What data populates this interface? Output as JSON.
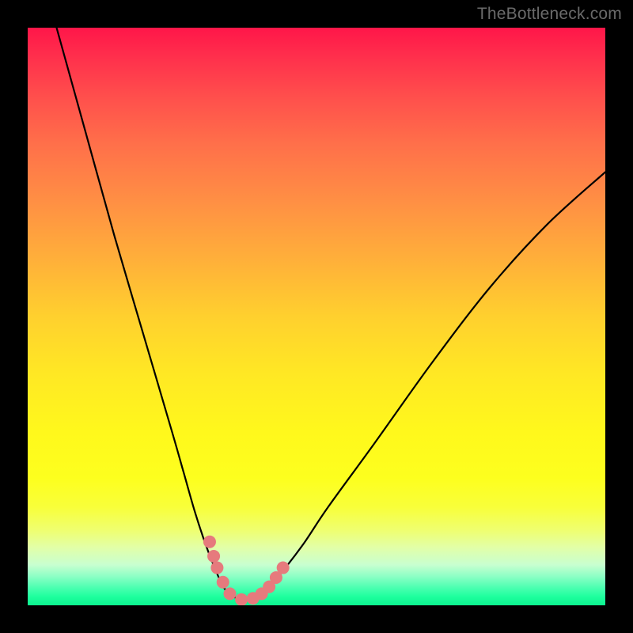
{
  "watermark": "TheBottleneck.com",
  "chart_data": {
    "type": "line",
    "title": "",
    "xlabel": "",
    "ylabel": "",
    "xlim": [
      0,
      100
    ],
    "ylim": [
      0,
      100
    ],
    "grid": false,
    "series": [
      {
        "name": "curve",
        "x": [
          5,
          10,
          15,
          20,
          25,
          27,
          29,
          31,
          33,
          34,
          35,
          36,
          37,
          38,
          39,
          40,
          42,
          45,
          48,
          52,
          60,
          70,
          80,
          90,
          100
        ],
        "y": [
          100,
          82,
          64,
          47,
          30,
          23,
          16,
          10,
          5,
          3,
          2,
          1.3,
          1,
          1,
          1.2,
          1.8,
          3.5,
          7,
          11,
          17,
          28,
          42,
          55,
          66,
          75
        ]
      }
    ],
    "markers": [
      {
        "x": 31.5,
        "y": 11
      },
      {
        "x": 32.2,
        "y": 8.5
      },
      {
        "x": 32.8,
        "y": 6.5
      },
      {
        "x": 33.8,
        "y": 4
      },
      {
        "x": 35.0,
        "y": 2
      },
      {
        "x": 37.0,
        "y": 1
      },
      {
        "x": 39.0,
        "y": 1.2
      },
      {
        "x": 40.5,
        "y": 2
      },
      {
        "x": 41.8,
        "y": 3.2
      },
      {
        "x": 43.0,
        "y": 4.8
      },
      {
        "x": 44.2,
        "y": 6.5
      }
    ],
    "gradient_stops": [
      {
        "pos": 0,
        "color": "#ff1649"
      },
      {
        "pos": 0.5,
        "color": "#ffd02e"
      },
      {
        "pos": 0.78,
        "color": "#fdff1e"
      },
      {
        "pos": 1.0,
        "color": "#0cf28f"
      }
    ]
  }
}
